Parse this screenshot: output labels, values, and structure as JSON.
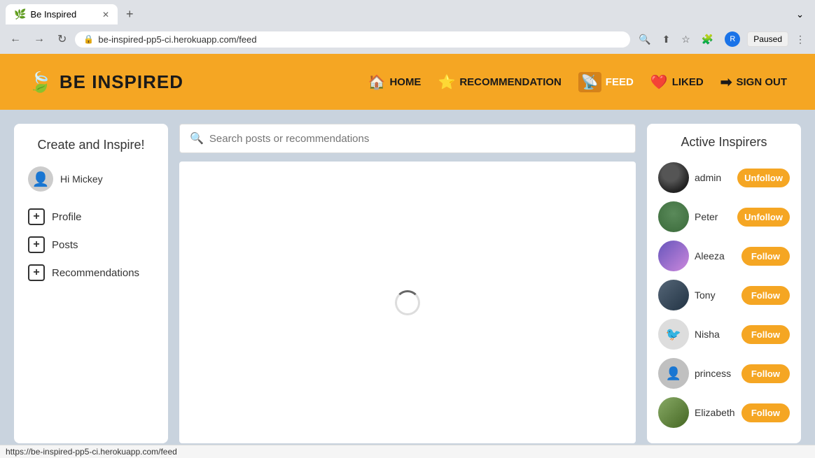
{
  "browser": {
    "tab_title": "Be Inspired",
    "tab_favicon": "🌟",
    "new_tab_label": "+",
    "address": "be-inspired-pp5-ci.herokuapp.com/feed",
    "lock_icon": "🔒",
    "search_icon": "🔍",
    "share_icon": "↑",
    "star_icon": "☆",
    "profile_initial": "R",
    "paused_label": "Paused",
    "tab_menu_label": "⌄"
  },
  "nav": {
    "brand_name": "BE INSPIRED",
    "links": [
      {
        "id": "home",
        "label": "HOME",
        "icon": "🏠"
      },
      {
        "id": "recommendation",
        "label": "RECOMMENDATION",
        "icon": "⭐"
      },
      {
        "id": "feed",
        "label": "FEED",
        "icon": "📡",
        "active": true
      },
      {
        "id": "liked",
        "label": "LIKED",
        "icon": "❤️"
      },
      {
        "id": "signout",
        "label": "SIGN OUT",
        "icon": "🚪"
      }
    ]
  },
  "sidebar": {
    "title": "Create and Inspire!",
    "user_greeting": "Hi Mickey",
    "menu_items": [
      {
        "id": "profile",
        "label": "Profile"
      },
      {
        "id": "posts",
        "label": "Posts"
      },
      {
        "id": "recommendations",
        "label": "Recommendations"
      }
    ]
  },
  "search": {
    "placeholder": "Search posts or recommendations"
  },
  "inspirers": {
    "title": "Active Inspirers",
    "users": [
      {
        "id": "admin",
        "name": "admin",
        "action": "Unfollow",
        "avatar_class": "avatar-admin-div"
      },
      {
        "id": "peter",
        "name": "Peter",
        "action": "Unfollow",
        "avatar_class": "avatar-peter-div"
      },
      {
        "id": "aleeza",
        "name": "Aleeza",
        "action": "Follow",
        "avatar_class": "avatar-aleeza-div"
      },
      {
        "id": "tony",
        "name": "Tony",
        "action": "Follow",
        "avatar_class": "avatar-tony-div"
      },
      {
        "id": "nisha",
        "name": "Nisha",
        "action": "Follow",
        "avatar_class": "avatar-nisha-div"
      },
      {
        "id": "princess",
        "name": "princess",
        "action": "Follow",
        "avatar_class": "avatar-princess-div"
      },
      {
        "id": "elizabeth",
        "name": "Elizabeth",
        "action": "Follow",
        "avatar_class": "avatar-elizabeth-div"
      }
    ]
  },
  "status_bar": {
    "url": "https://be-inspired-pp5-ci.herokuapp.com/feed"
  }
}
